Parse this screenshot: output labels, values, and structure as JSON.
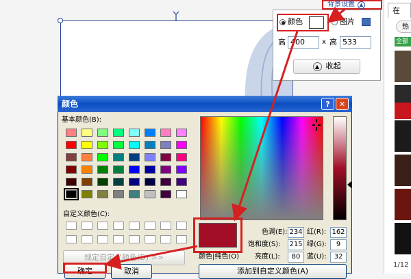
{
  "bg_settings": {
    "header": "背景设置",
    "color_label": "颜色",
    "picture_label": "图片",
    "height_label": "高",
    "height_value": "400",
    "times": "x",
    "width_label": "高",
    "width_value": "533",
    "collapse": "收起"
  },
  "right_panel": {
    "tab": "在",
    "hot": "热",
    "all": "全部",
    "page": "1/12"
  },
  "dialog": {
    "title": "颜色",
    "basic_colors_label": "基本颜色(B):",
    "custom_colors_label": "自定义颜色(C):",
    "define_custom": "规定自定义颜色(D) >>",
    "ok": "确定",
    "cancel": "取消",
    "color_solid": "颜色|纯色(O)",
    "add_custom": "添加到自定义颜色(A)",
    "hue_label": "色调(E):",
    "hue": "234",
    "sat_label": "饱和度(S):",
    "sat": "215",
    "lum_label": "亮度(L):",
    "lum": "80",
    "red_label": "红(R):",
    "red": "162",
    "green_label": "绿(G):",
    "green": "9",
    "blue_label": "蓝(U):",
    "blue": "32",
    "selected_color": "#a20e26",
    "basic_colors": [
      "#ff8080",
      "#ffff80",
      "#80ff80",
      "#00ff80",
      "#80ffff",
      "#0080ff",
      "#ff80c0",
      "#ff80ff",
      "#ff0000",
      "#ffff00",
      "#80ff00",
      "#00ff40",
      "#00ffff",
      "#0080c0",
      "#8080c0",
      "#ff00ff",
      "#804040",
      "#ff8040",
      "#00ff00",
      "#008080",
      "#004080",
      "#8080ff",
      "#800040",
      "#ff0080",
      "#800000",
      "#ff8000",
      "#008000",
      "#008040",
      "#0000ff",
      "#0000a0",
      "#800080",
      "#8000ff",
      "#400000",
      "#804000",
      "#004000",
      "#004040",
      "#000080",
      "#000040",
      "#400040",
      "#400080",
      "#000000",
      "#808000",
      "#808040",
      "#808080",
      "#408080",
      "#c0c0c0",
      "#400040",
      "#ffffff"
    ]
  },
  "colors": {
    "accent_red": "#d62020",
    "title_blue": "#0a4fc3"
  }
}
